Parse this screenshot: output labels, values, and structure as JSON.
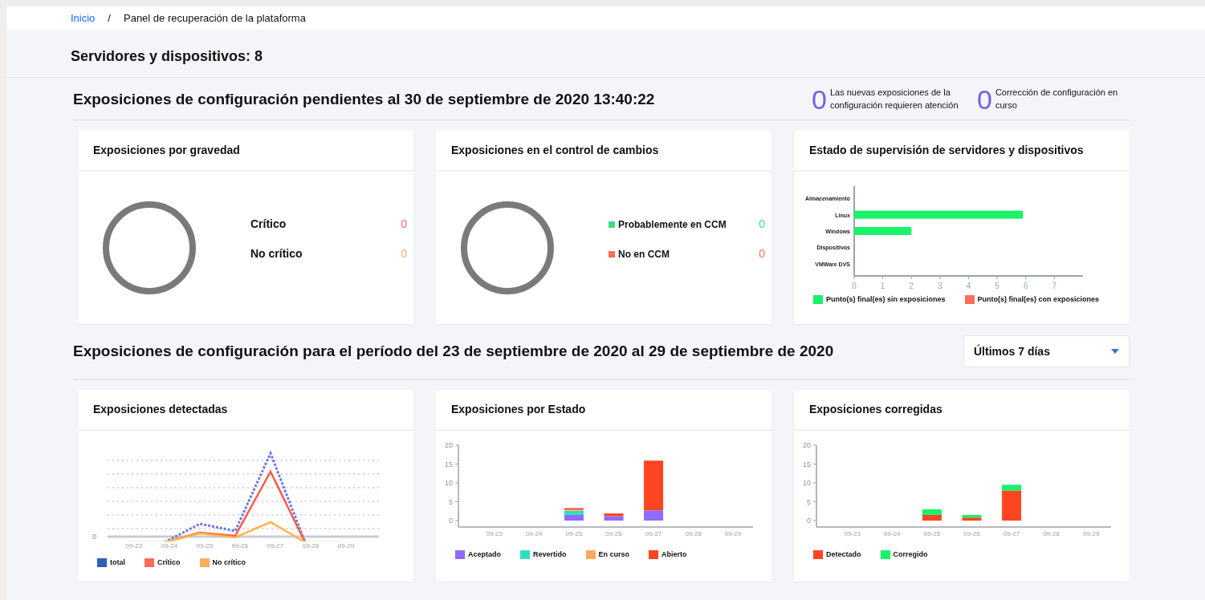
{
  "breadcrumb": [
    {
      "label": "Inicio",
      "kind": "link"
    },
    {
      "label": "/",
      "kind": "separator"
    },
    {
      "label": "Panel de recuperación de la plataforma",
      "kind": "current"
    }
  ],
  "page_title": "Servidores y dispositivos: 8",
  "pending": {
    "title": "Exposiciones de configuración pendientes al 30 de septiembre de 2020 13:40:22",
    "counters": [
      {
        "value": "0",
        "label": "Las nuevas exposiciones de la configuración requieren atención"
      },
      {
        "value": "0",
        "label": "Corrección de configuración en curso"
      }
    ],
    "cards": [
      {
        "title": "Exposiciones por gravedad",
        "kind": "donut",
        "legend_swatches": false,
        "legend": [
          {
            "label": "Crítico",
            "value": "0",
            "color": "#ff6b5b"
          },
          {
            "label": "No crítico",
            "value": "0",
            "color": "#ffab5e"
          }
        ]
      },
      {
        "title": "Exposiciones en el control de cambios",
        "kind": "donut",
        "legend_swatches": true,
        "legend": [
          {
            "label": "Probablemente en CCM",
            "value": "0",
            "color": "#3ddc84"
          },
          {
            "label": "No en CCM",
            "value": "0",
            "color": "#ff6b5b"
          }
        ]
      },
      {
        "title": "Estado de supervisión de servidores y dispositivos",
        "kind": "chart",
        "chart_data": {
          "type": "bar",
          "orientation": "horizontal",
          "stacked": true,
          "legend": "bottom",
          "categories": [
            "Almacenamiento",
            "Linux",
            "Windows",
            "Dispositivos",
            "VMWare DVS"
          ],
          "xlim": [
            0,
            8
          ],
          "xticks": [
            0,
            1,
            2,
            3,
            4,
            5,
            6,
            7
          ],
          "series": [
            {
              "name": "Punto(s) final(es) sin exposiciones",
              "color": "#19f26b",
              "values": [
                0,
                5.9,
                2,
                0,
                0
              ]
            },
            {
              "name": "Punto(s) final(es) con exposiciones",
              "color": "#ff6b5b",
              "values": [
                0,
                0,
                0,
                0,
                0
              ]
            }
          ]
        }
      }
    ]
  },
  "period": {
    "title": "Exposiciones de configuración para el período del 23 de septiembre de 2020 al 29 de septiembre de 2020",
    "range_select": {
      "value": "Últimos 7 días"
    },
    "cards": [
      {
        "title": "Exposiciones detectadas",
        "kind": "line_picture",
        "y_label": "0",
        "x_labels": [
          "09-23",
          "09-24",
          "09-25",
          "09-26",
          "09-27",
          "09-28",
          "09-29"
        ],
        "legend": [
          {
            "label": "total",
            "color": "#2f5fb3"
          },
          {
            "label": "Crítico",
            "color": "#ff6b5b"
          },
          {
            "label": "No crítico",
            "color": "#ffab5e"
          }
        ]
      },
      {
        "title": "Exposiciones por Estado",
        "kind": "chart",
        "chart_data": {
          "type": "bar",
          "orientation": "vertical",
          "stacked": true,
          "legend": "bottom",
          "categories": [
            "09-23",
            "09-24",
            "09-25",
            "09-26",
            "09-27",
            "09-28",
            "09-29"
          ],
          "ylim": [
            0,
            20
          ],
          "yticks": [
            0,
            5,
            10,
            15,
            20
          ],
          "series": [
            {
              "name": "Aceptado",
              "color": "#8f6bff",
              "values": [
                0,
                0,
                1.5,
                1.2,
                2.7,
                0,
                0
              ]
            },
            {
              "name": "Revertido",
              "color": "#2fe0bf",
              "values": [
                0,
                0,
                1.1,
                0,
                0,
                0,
                0
              ]
            },
            {
              "name": "En curso",
              "color": "#ffaa5e",
              "values": [
                0,
                0,
                0.3,
                0,
                0,
                0,
                0
              ]
            },
            {
              "name": "Abierto",
              "color": "#ff4422",
              "values": [
                0,
                0,
                0.4,
                0.7,
                13.2,
                0,
                0
              ]
            }
          ]
        }
      },
      {
        "title": "Exposiciones corregidas",
        "kind": "chart",
        "chart_data": {
          "type": "bar",
          "orientation": "vertical",
          "stacked": true,
          "legend": "bottom",
          "categories": [
            "09-23",
            "09-24",
            "09-25",
            "09-26",
            "09-27",
            "09-28",
            "09-29"
          ],
          "ylim": [
            0,
            20
          ],
          "yticks": [
            0,
            5,
            10,
            15,
            20
          ],
          "series": [
            {
              "name": "Detectado",
              "color": "#ff4422",
              "values": [
                0,
                0,
                1.5,
                0.8,
                8,
                0,
                0
              ]
            },
            {
              "name": "Corregido",
              "color": "#19f26b",
              "values": [
                0,
                0,
                1.5,
                0.7,
                1.5,
                0,
                0
              ]
            }
          ]
        }
      }
    ]
  }
}
